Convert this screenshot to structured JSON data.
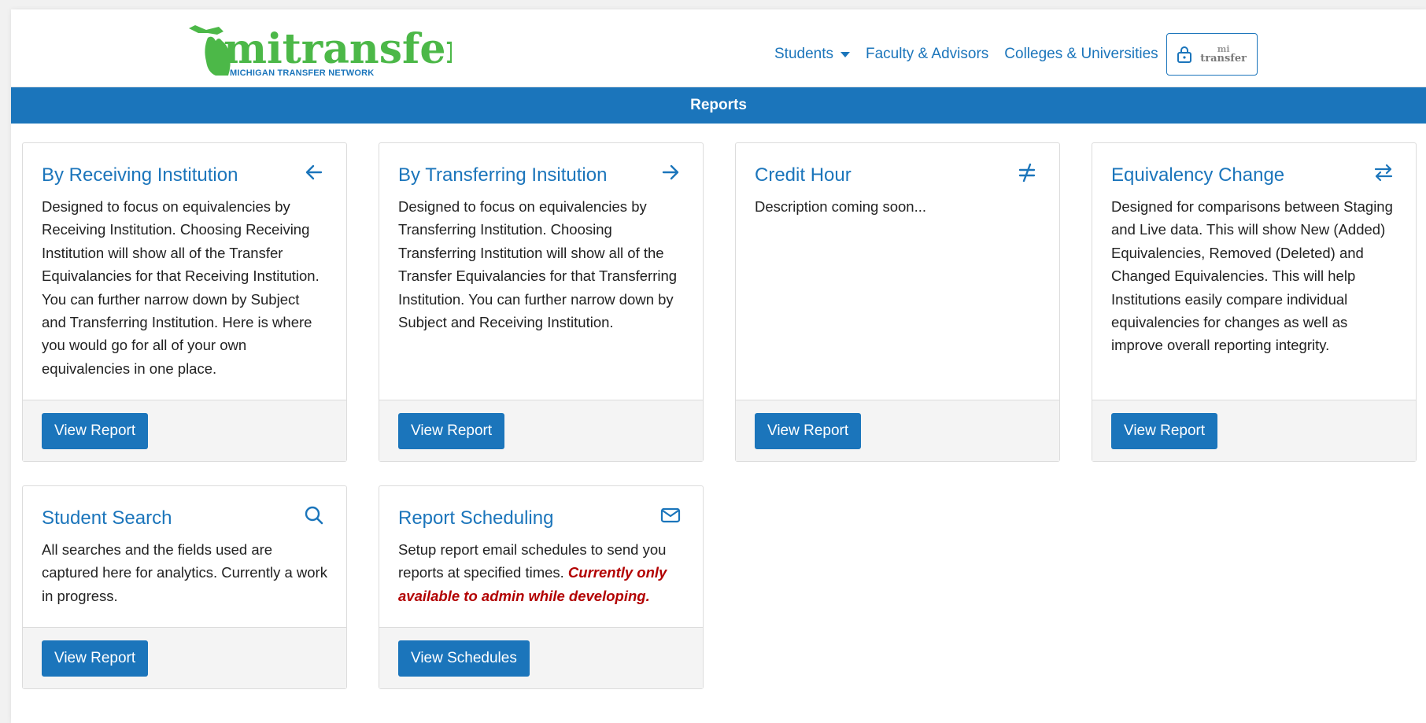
{
  "header": {
    "logo": {
      "word": "mitransfer",
      "tagline": "MICHIGAN TRANSFER NETWORK"
    },
    "nav": [
      {
        "label": "Students",
        "has_dropdown": true
      },
      {
        "label": "Faculty & Advisors"
      },
      {
        "label": "Colleges & Universities"
      }
    ],
    "login": {
      "icon": "lock-icon",
      "logo_line1": "mi",
      "logo_line2": "transfer"
    }
  },
  "banner": {
    "title": "Reports"
  },
  "cards": [
    {
      "title": "By Receiving Institution",
      "icon": "arrow-left-icon",
      "text": "Designed to focus on equivalencies by Receiving Institution. Choosing Receiving Institution will show all of the Transfer Equivalancies for that Receiving Institution. You can further narrow down by Subject and Transferring Institution. Here is where you would go for all of your own equivalencies in one place.",
      "button": "View Report"
    },
    {
      "title": "By Transferring Insitution",
      "icon": "arrow-right-icon",
      "text": "Designed to focus on equivalencies by Transferring Institution. Choosing Transferring Institution will show all of the Transfer Equivalancies for that Transferring Institution. You can further narrow down by Subject and Receiving Institution.",
      "button": "View Report"
    },
    {
      "title": "Credit Hour",
      "icon": "not-equal-icon",
      "text": "Description coming soon...",
      "button": "View Report"
    },
    {
      "title": "Equivalency Change",
      "icon": "swap-arrows-icon",
      "text": "Designed for comparisons between Staging and Live data. This will show New (Added) Equivalencies, Removed (Deleted) and Changed Equivalencies. This will help Institutions easily compare individual equivalencies for changes as well as improve overall reporting integrity.",
      "button": "View Report"
    },
    {
      "title": "Student Search",
      "icon": "search-icon",
      "text": "All searches and the fields used are captured here for analytics. Currently a work in progress.",
      "button": "View Report"
    },
    {
      "title": "Report Scheduling",
      "icon": "envelope-icon",
      "text": "Setup report email schedules to send you reports at specified times.",
      "warning": "Currently only available to admin while developing.",
      "button": "View Schedules"
    }
  ],
  "colors": {
    "primary": "#1b75bb",
    "logo_green": "#4cb848",
    "warning": "#b20000",
    "footer_bg": "#f4f4f4"
  }
}
